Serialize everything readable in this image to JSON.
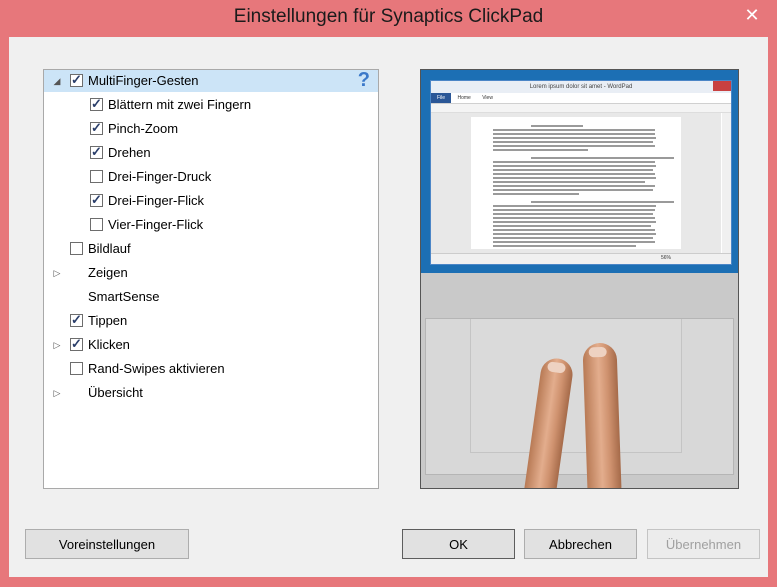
{
  "window": {
    "title": "Einstellungen für Synaptics ClickPad",
    "close_glyph": "✕"
  },
  "tree": {
    "help_glyph": "?",
    "items": [
      {
        "label": "MultiFinger-Gesten",
        "checked": true,
        "expand": "open",
        "selected": true
      },
      {
        "label": "Blättern mit zwei Fingern",
        "checked": true
      },
      {
        "label": "Pinch-Zoom",
        "checked": true
      },
      {
        "label": "Drehen",
        "checked": true
      },
      {
        "label": "Drei-Finger-Druck",
        "checked": false
      },
      {
        "label": "Drei-Finger-Flick",
        "checked": true
      },
      {
        "label": "Vier-Finger-Flick",
        "checked": false
      },
      {
        "label": "Bildlauf",
        "checked": false
      },
      {
        "label": "Zeigen",
        "expand": "closed"
      },
      {
        "label": "SmartSense"
      },
      {
        "label": "Tippen",
        "checked": true
      },
      {
        "label": "Klicken",
        "checked": true,
        "expand": "closed"
      },
      {
        "label": "Rand-Swipes aktivieren",
        "checked": false
      },
      {
        "label": "Übersicht",
        "expand": "closed"
      }
    ]
  },
  "preview": {
    "wordpad_title": "Lorem ipsum dolor sit amet - WordPad",
    "tabs": [
      "File",
      "Home",
      "View"
    ],
    "zoom": "56%"
  },
  "buttons": {
    "defaults": "Voreinstellungen",
    "ok": "OK",
    "cancel": "Abbrechen",
    "apply": "Übernehmen"
  },
  "colors": {
    "accent": "#e7777b",
    "selection": "#cce4f7",
    "screen_blue": "#1c6fb4"
  }
}
